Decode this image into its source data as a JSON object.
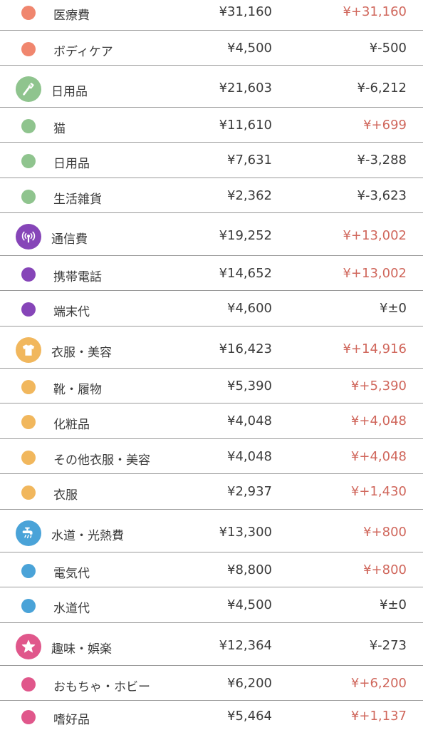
{
  "colors": {
    "medical": "#f0866e",
    "daily": "#8fc48e",
    "telecom": "#8645b8",
    "clothing": "#f1b75d",
    "utility": "#4aa3d8",
    "hobby": "#e0578b",
    "increase": "#d0675c",
    "decrease": "#3b3b3b",
    "divider": "#9a9a9a"
  },
  "rows": [
    {
      "name": "医療費",
      "amount": "¥31,160",
      "diff": "¥+31,160",
      "sign": "pos",
      "color": "medical",
      "kind": "sub"
    },
    {
      "name": "ボディケア",
      "amount": "¥4,500",
      "diff": "¥-500",
      "sign": "neg",
      "color": "medical",
      "kind": "sub"
    },
    {
      "name": "日用品",
      "amount": "¥21,603",
      "diff": "¥-6,212",
      "sign": "neg",
      "color": "daily",
      "kind": "cat",
      "icon": "toothbrush-icon"
    },
    {
      "name": "猫",
      "amount": "¥11,610",
      "diff": "¥+699",
      "sign": "pos",
      "color": "daily",
      "kind": "sub"
    },
    {
      "name": "日用品",
      "amount": "¥7,631",
      "diff": "¥-3,288",
      "sign": "neg",
      "color": "daily",
      "kind": "sub"
    },
    {
      "name": "生活雑貨",
      "amount": "¥2,362",
      "diff": "¥-3,623",
      "sign": "neg",
      "color": "daily",
      "kind": "sub"
    },
    {
      "name": "通信費",
      "amount": "¥19,252",
      "diff": "¥+13,002",
      "sign": "pos",
      "color": "telecom",
      "kind": "cat",
      "icon": "antenna-icon"
    },
    {
      "name": "携帯電話",
      "amount": "¥14,652",
      "diff": "¥+13,002",
      "sign": "pos",
      "color": "telecom",
      "kind": "sub"
    },
    {
      "name": "端末代",
      "amount": "¥4,600",
      "diff": "¥±0",
      "sign": "neg",
      "color": "telecom",
      "kind": "sub"
    },
    {
      "name": "衣服・美容",
      "amount": "¥16,423",
      "diff": "¥+14,916",
      "sign": "pos",
      "color": "clothing",
      "kind": "cat",
      "icon": "tshirt-icon"
    },
    {
      "name": "靴・履物",
      "amount": "¥5,390",
      "diff": "¥+5,390",
      "sign": "pos",
      "color": "clothing",
      "kind": "sub"
    },
    {
      "name": "化粧品",
      "amount": "¥4,048",
      "diff": "¥+4,048",
      "sign": "pos",
      "color": "clothing",
      "kind": "sub"
    },
    {
      "name": "その他衣服・美容",
      "amount": "¥4,048",
      "diff": "¥+4,048",
      "sign": "pos",
      "color": "clothing",
      "kind": "sub"
    },
    {
      "name": "衣服",
      "amount": "¥2,937",
      "diff": "¥+1,430",
      "sign": "pos",
      "color": "clothing",
      "kind": "sub"
    },
    {
      "name": "水道・光熱費",
      "amount": "¥13,300",
      "diff": "¥+800",
      "sign": "pos",
      "color": "utility",
      "kind": "cat",
      "icon": "faucet-icon"
    },
    {
      "name": "電気代",
      "amount": "¥8,800",
      "diff": "¥+800",
      "sign": "pos",
      "color": "utility",
      "kind": "sub"
    },
    {
      "name": "水道代",
      "amount": "¥4,500",
      "diff": "¥±0",
      "sign": "neg",
      "color": "utility",
      "kind": "sub"
    },
    {
      "name": "趣味・娯楽",
      "amount": "¥12,364",
      "diff": "¥-273",
      "sign": "neg",
      "color": "hobby",
      "kind": "cat",
      "icon": "star-icon"
    },
    {
      "name": "おもちゃ・ホビー",
      "amount": "¥6,200",
      "diff": "¥+6,200",
      "sign": "pos",
      "color": "hobby",
      "kind": "sub"
    },
    {
      "name": "嗜好品",
      "amount": "¥5,464",
      "diff": "¥+1,137",
      "sign": "pos",
      "color": "hobby",
      "kind": "sub"
    }
  ]
}
